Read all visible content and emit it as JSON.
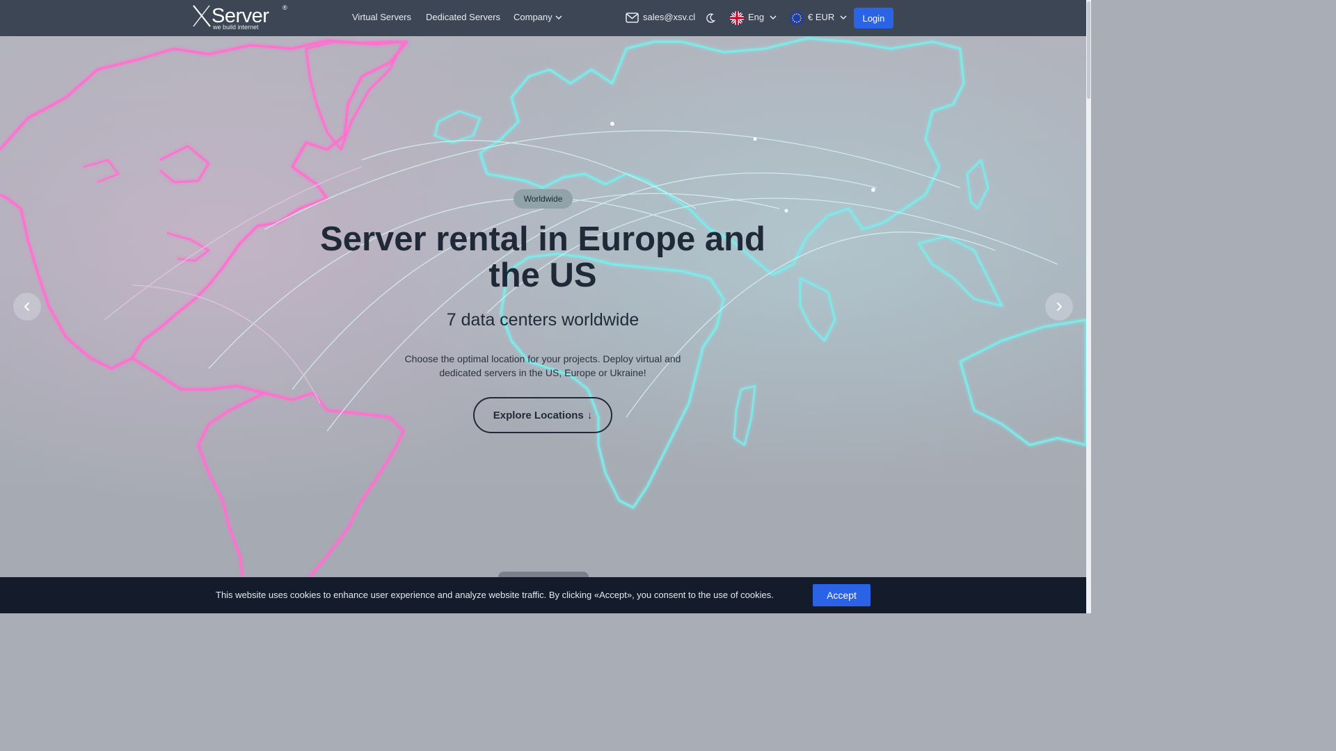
{
  "header": {
    "logo_text": "Server",
    "logo_registered": "®",
    "logo_tagline": "we build internet",
    "nav": [
      {
        "label": "Virtual Servers"
      },
      {
        "label": "Dedicated Servers"
      },
      {
        "label": "Company"
      }
    ],
    "email": "sales@xsv.cl",
    "language": "Eng",
    "currency": "€ EUR",
    "login_label": "Login"
  },
  "hero": {
    "badge": "Worldwide",
    "title": "Server rental in Europe and the US",
    "subtitle": "7 data centers worldwide",
    "description": "Choose the optimal location for your projects. Deploy virtual and dedicated servers in the US, Europe or Ukraine!",
    "cta_label": "Explore Locations",
    "cta_arrow": "↓"
  },
  "cookie": {
    "text": "This website uses cookies to enhance user experience and analyze website traffic. By clicking «Accept», you consent to the use of cookies.",
    "accept_label": "Accept"
  },
  "colors": {
    "navbar_bg": "#3d4654",
    "primary": "#2b63e6",
    "cookie_bg": "#141c2b",
    "map_americas": "#ff6fd0",
    "map_world": "#7fe9ea"
  },
  "icons": [
    "x-logo-icon",
    "chevron-down-icon",
    "mail-icon",
    "moon-icon",
    "uk-flag-icon",
    "eu-flag-icon",
    "chevron-left-icon",
    "chevron-right-icon"
  ]
}
